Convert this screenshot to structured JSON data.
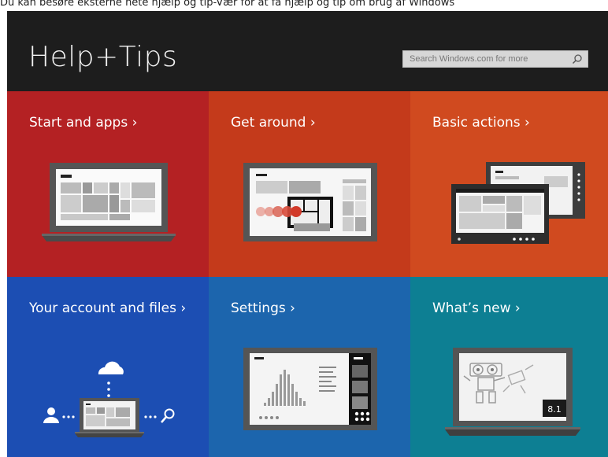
{
  "caption": "Du kan besøre eksterne nete hjælp og tip-Vær for at få hjælp og tip om brug af Windows",
  "app": {
    "title": "Help+Tips",
    "search_placeholder": "Search Windows.com for more"
  },
  "tiles": [
    {
      "id": "start-and-apps",
      "label": "Start and apps ›",
      "color": "#b42123"
    },
    {
      "id": "get-around",
      "label": "Get around ›",
      "color": "#c43a1b"
    },
    {
      "id": "basic-actions",
      "label": "Basic actions ›",
      "color": "#d04a1f"
    },
    {
      "id": "your-account-and-files",
      "label": "Your account and files ›",
      "color": "#1c4eb3"
    },
    {
      "id": "settings",
      "label": "Settings ›",
      "color": "#1c65ad"
    },
    {
      "id": "whats-new",
      "label": "What’s new ›",
      "color": "#0d7f93"
    }
  ],
  "whats_new_badge": "8.1",
  "icons": {
    "search": "search-icon",
    "laptop": "laptop-icon",
    "tablet": "tablet-icon",
    "cloud": "cloud-icon",
    "person": "person-icon",
    "robot": "robot-icon"
  }
}
